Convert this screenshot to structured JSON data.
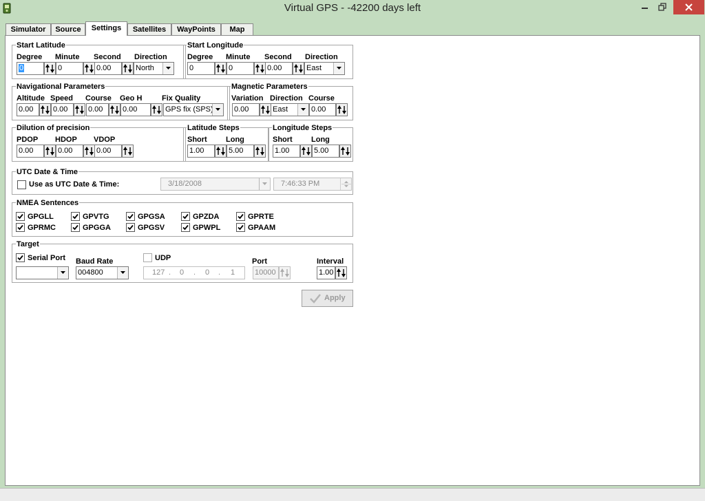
{
  "window": {
    "title": "Virtual GPS - -42200 days left"
  },
  "tabs": [
    {
      "label": "Simulator"
    },
    {
      "label": "Source"
    },
    {
      "label": "Settings"
    },
    {
      "label": "Satellites"
    },
    {
      "label": "WayPoints"
    },
    {
      "label": "Map"
    }
  ],
  "start_latitude": {
    "title": "Start Latitude",
    "degree_label": "Degree",
    "degree": "0",
    "minute_label": "Minute",
    "minute": "0",
    "second_label": "Second",
    "second": "0.00",
    "direction_label": "Direction",
    "direction": "North"
  },
  "start_longitude": {
    "title": "Start Longitude",
    "degree_label": "Degree",
    "degree": "0",
    "minute_label": "Minute",
    "minute": "0",
    "second_label": "Second",
    "second": "0.00",
    "direction_label": "Direction",
    "direction": "East"
  },
  "nav": {
    "title": "Navigational Parameters",
    "altitude_label": "Altitude",
    "altitude": "0.00",
    "speed_label": "Speed",
    "speed": "0.00",
    "course_label": "Course",
    "course": "0.00",
    "geoh_label": "Geo H",
    "geoh": "0.00",
    "fix_label": "Fix Quality",
    "fix": "GPS fix (SPS)"
  },
  "magnetic": {
    "title": "Magnetic Parameters",
    "variation_label": "Variation",
    "variation": "0.00",
    "direction_label": "Direction",
    "direction": "East",
    "course_label": "Course",
    "course": "0.00"
  },
  "dop": {
    "title": "Dilution of precision",
    "pdop_label": "PDOP",
    "pdop": "0.00",
    "hdop_label": "HDOP",
    "hdop": "0.00",
    "vdop_label": "VDOP",
    "vdop": "0.00"
  },
  "lat_steps": {
    "title": "Latitude Steps",
    "short_label": "Short",
    "short": "1.00",
    "long_label": "Long",
    "long": "5.00"
  },
  "lon_steps": {
    "title": "Longitude Steps",
    "short_label": "Short",
    "short": "1.00",
    "long_label": "Long",
    "long": "5.00"
  },
  "utc": {
    "title": "UTC Date & Time",
    "use_label": "Use as UTC Date & Time:",
    "date": "3/18/2008",
    "time": "7:46:33 PM"
  },
  "nmea": {
    "title": "NMEA Sentences",
    "items": [
      {
        "label": "GPGLL"
      },
      {
        "label": "GPVTG"
      },
      {
        "label": "GPGSA"
      },
      {
        "label": "GPZDA"
      },
      {
        "label": "GPRTE"
      },
      {
        "label": "GPRMC"
      },
      {
        "label": "GPGGA"
      },
      {
        "label": "GPGSV"
      },
      {
        "label": "GPWPL"
      },
      {
        "label": "GPAAM"
      }
    ]
  },
  "target": {
    "title": "Target",
    "serial_label": "Serial Port",
    "serial_port": "",
    "baud_label": "Baud Rate",
    "baud": "004800",
    "udp_label": "UDP",
    "ip": [
      "127",
      "0",
      "0",
      "1"
    ],
    "port_label": "Port",
    "port": "10000",
    "interval_label": "Interval",
    "interval": "1.00"
  },
  "apply_label": "Apply"
}
